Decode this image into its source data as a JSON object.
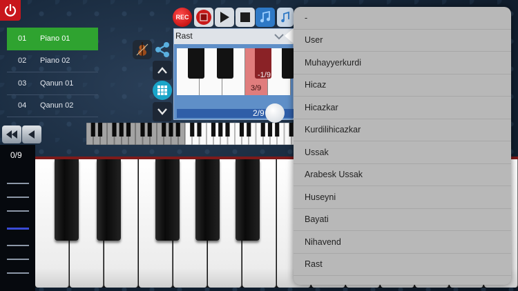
{
  "toolbar": {
    "rec_label": "REC"
  },
  "instruments": [
    {
      "num": "01",
      "name": "Piano 01",
      "selected": true
    },
    {
      "num": "02",
      "name": "Piano 02",
      "selected": false
    },
    {
      "num": "03",
      "name": "Qanun 01",
      "selected": false
    },
    {
      "num": "04",
      "name": "Qanun 02",
      "selected": false
    }
  ],
  "maqam": {
    "selected": "Rast",
    "highlight_note_offset": "-1/9",
    "highlight_note_value": "3/9",
    "slider_value": "2/9"
  },
  "tuning_readout": "0/9",
  "dropdown": {
    "options": [
      "-",
      "User",
      "Muhayyerkurdi",
      "Hicaz",
      "Hicazkar",
      "Kurdilihicazkar",
      "Ussak",
      "Arabesk Ussak",
      "Huseyni",
      "Bayati",
      "Nihavend",
      "Rast"
    ]
  },
  "colors": {
    "selected_instrument": "#2fa330",
    "record": "#c8161c",
    "highlight_note": "#e07d7d",
    "meter_active": "#3a4bd6"
  }
}
